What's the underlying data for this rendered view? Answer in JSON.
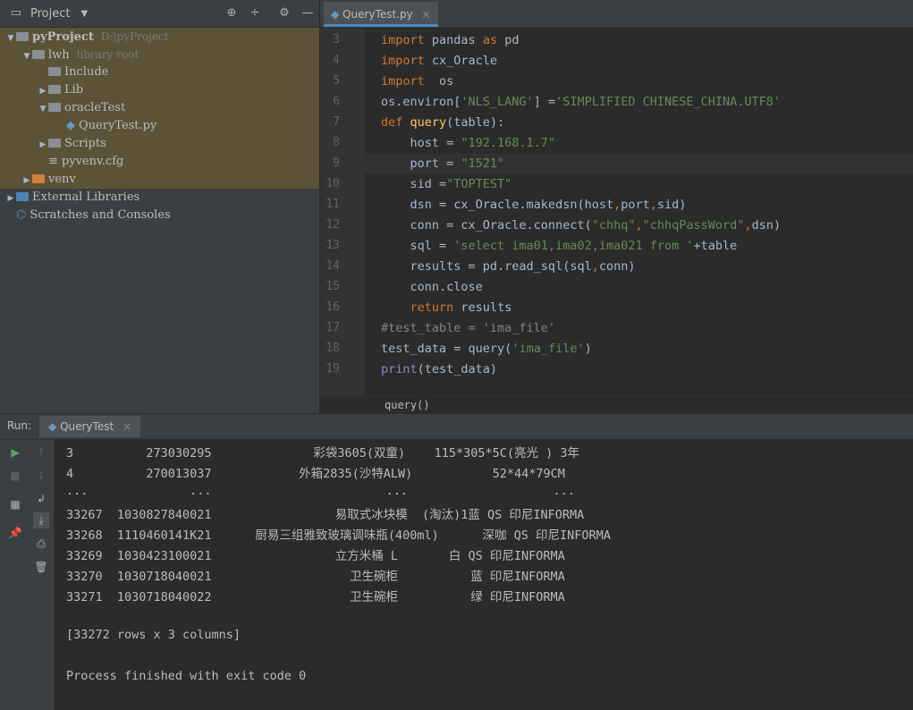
{
  "project": {
    "header_title": "Project",
    "tree": [
      {
        "arrow": "▼",
        "label": "pyProject",
        "hint": "D:\\pyProject",
        "icon": "folder"
      },
      {
        "arrow": "▼",
        "label": "lwh",
        "hint": "library root",
        "icon": "folder"
      },
      {
        "arrow": "",
        "label": "Include",
        "hint": "",
        "icon": "folder"
      },
      {
        "arrow": "▶",
        "label": "Lib",
        "hint": "",
        "icon": "folder"
      },
      {
        "arrow": "▼",
        "label": "oracleTest",
        "hint": "",
        "icon": "folder"
      },
      {
        "arrow": "",
        "label": "QueryTest.py",
        "hint": "",
        "icon": "python-file"
      },
      {
        "arrow": "▶",
        "label": "Scripts",
        "hint": "",
        "icon": "folder"
      },
      {
        "arrow": "",
        "label": "pyvenv.cfg",
        "hint": "",
        "icon": "text-file"
      },
      {
        "arrow": "▶",
        "label": "venv",
        "hint": "",
        "icon": "folder-orange"
      },
      {
        "arrow": "▶",
        "label": "External Libraries",
        "hint": "",
        "icon": "library"
      },
      {
        "arrow": "",
        "label": "Scratches and Consoles",
        "hint": "",
        "icon": "scratches"
      }
    ]
  },
  "editor": {
    "tab_label": "QueryTest.py",
    "tab_close": "×",
    "line_numbers": [
      "3",
      "4",
      "5",
      "6",
      "7",
      "8",
      "9",
      "10",
      "11",
      "12",
      "13",
      "14",
      "15",
      "16",
      "17",
      "18",
      "19"
    ],
    "breadcrumb": "query()"
  },
  "run": {
    "label": "Run:",
    "tab_label": "QueryTest",
    "tab_close": "×",
    "console_lines": [
      "3          273030295              彩袋3605(双童)    115*305*5C(亮光 ) 3年",
      "4          270013037            外箱2835(沙特ALW)           52*44*79CM",
      "...              ...                        ...                    ...",
      "33267  1030827840021                 易取式冰块模  (淘汰)1蓝 QS 印尼INFORMA",
      "33268  1110460141K21      厨易三组雅致玻璃调味瓶(400ml)      深咖 QS 印尼INFORMA",
      "33269  1030423100021                 立方米桶 L       白 QS 印尼INFORMA",
      "33270  1030718040021                   卫生碗柜          蓝 印尼INFORMA",
      "33271  1030718040022                   卫生碗柜          绿 印尼INFORMA",
      "",
      "[33272 rows x 3 columns]",
      "",
      "Process finished with exit code 0"
    ]
  },
  "colors": {
    "keyword": "#cc7832",
    "string": "#6a8759",
    "function": "#ffc66d",
    "comment": "#808080",
    "builtin": "#8888c6"
  }
}
